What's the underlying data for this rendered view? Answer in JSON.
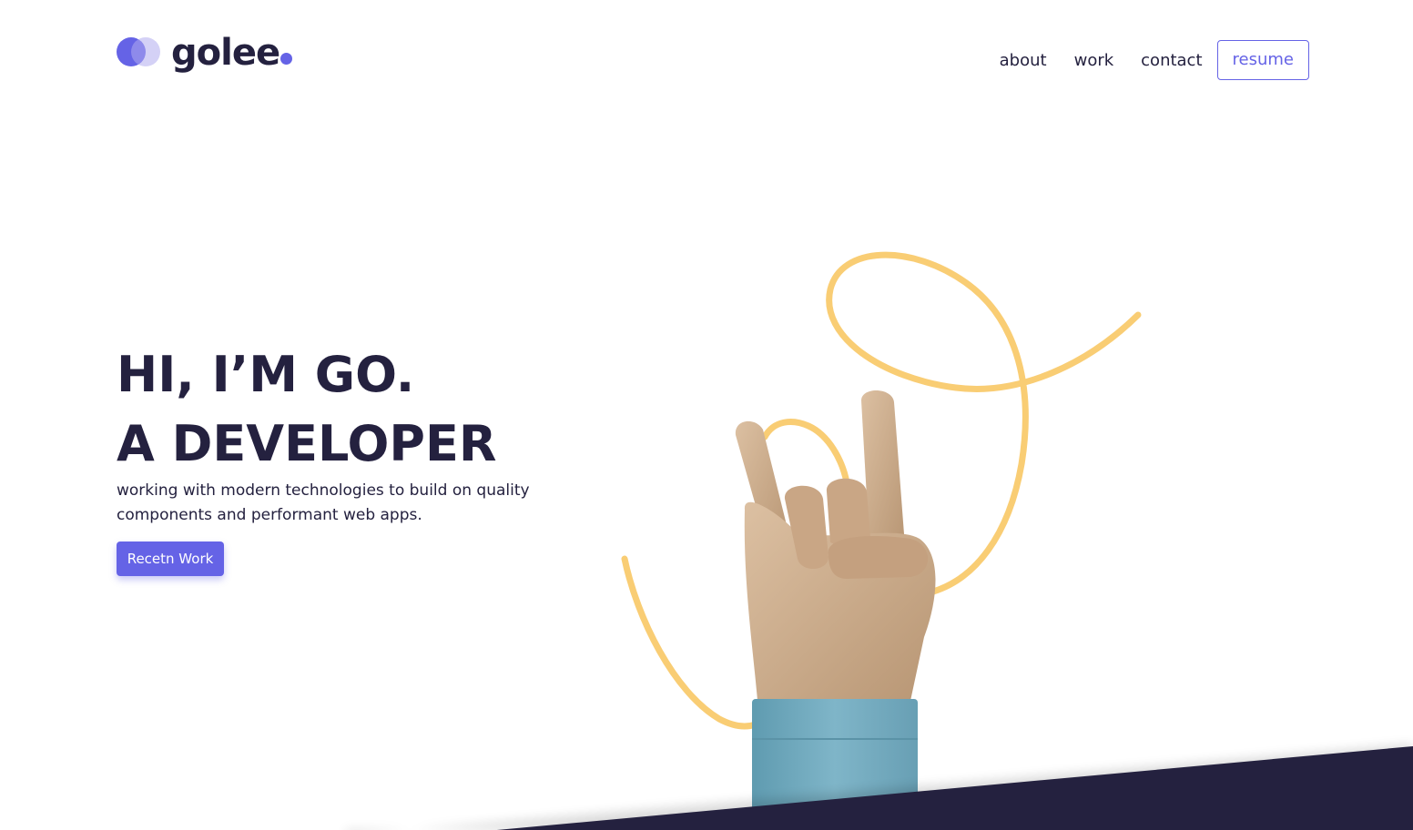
{
  "brand": {
    "name": "golee",
    "accent_color": "#6563e6",
    "dark_color": "#24213f"
  },
  "nav": {
    "items": [
      {
        "label": "about"
      },
      {
        "label": "work"
      },
      {
        "label": "contact"
      }
    ],
    "resume_label": "resume"
  },
  "hero": {
    "title_line1": "HI, I’M GO.",
    "title_line2": "A DEVELOPER",
    "subtitle": "working with modern technologies to build on quality components and performant web apps.",
    "cta_label": "Recetn Work"
  },
  "illustration": {
    "icon": "rock-on-hand-icon",
    "squiggle_color": "#f9cd74",
    "skin_color": "#cfae8e",
    "sleeve_color": "#78afc2"
  }
}
